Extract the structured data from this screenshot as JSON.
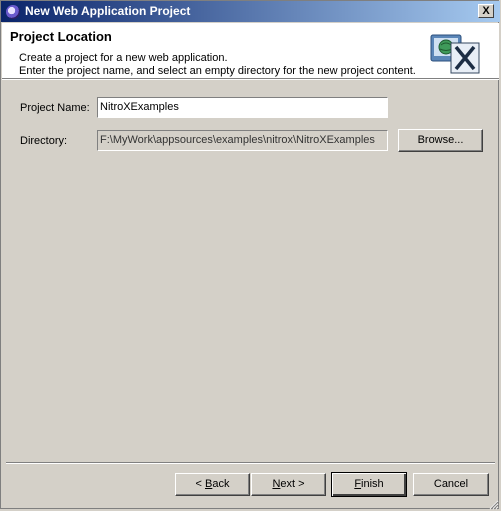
{
  "window": {
    "title": "New Web Application Project",
    "close_label": "X"
  },
  "header": {
    "title": "Project Location",
    "description_line1": "Create a project for a new web application.",
    "description_line2": "Enter the project name, and select an empty directory for the new project content.",
    "graphic_icon": "web-project-wizard-icon"
  },
  "form": {
    "project_name_label": "Project Name:",
    "project_name_value": "NitroXExamples",
    "directory_label": "Directory:",
    "directory_value": "F:\\MyWork\\appsources\\examples\\nitrox\\NitroXExamples",
    "browse_label": "Browse..."
  },
  "buttons": {
    "back_prefix": "< ",
    "back_mnemonic": "B",
    "back_rest": "ack",
    "next_mnemonic": "N",
    "next_rest": "ext >",
    "finish_mnemonic": "F",
    "finish_rest": "inish",
    "cancel_label": "Cancel"
  }
}
